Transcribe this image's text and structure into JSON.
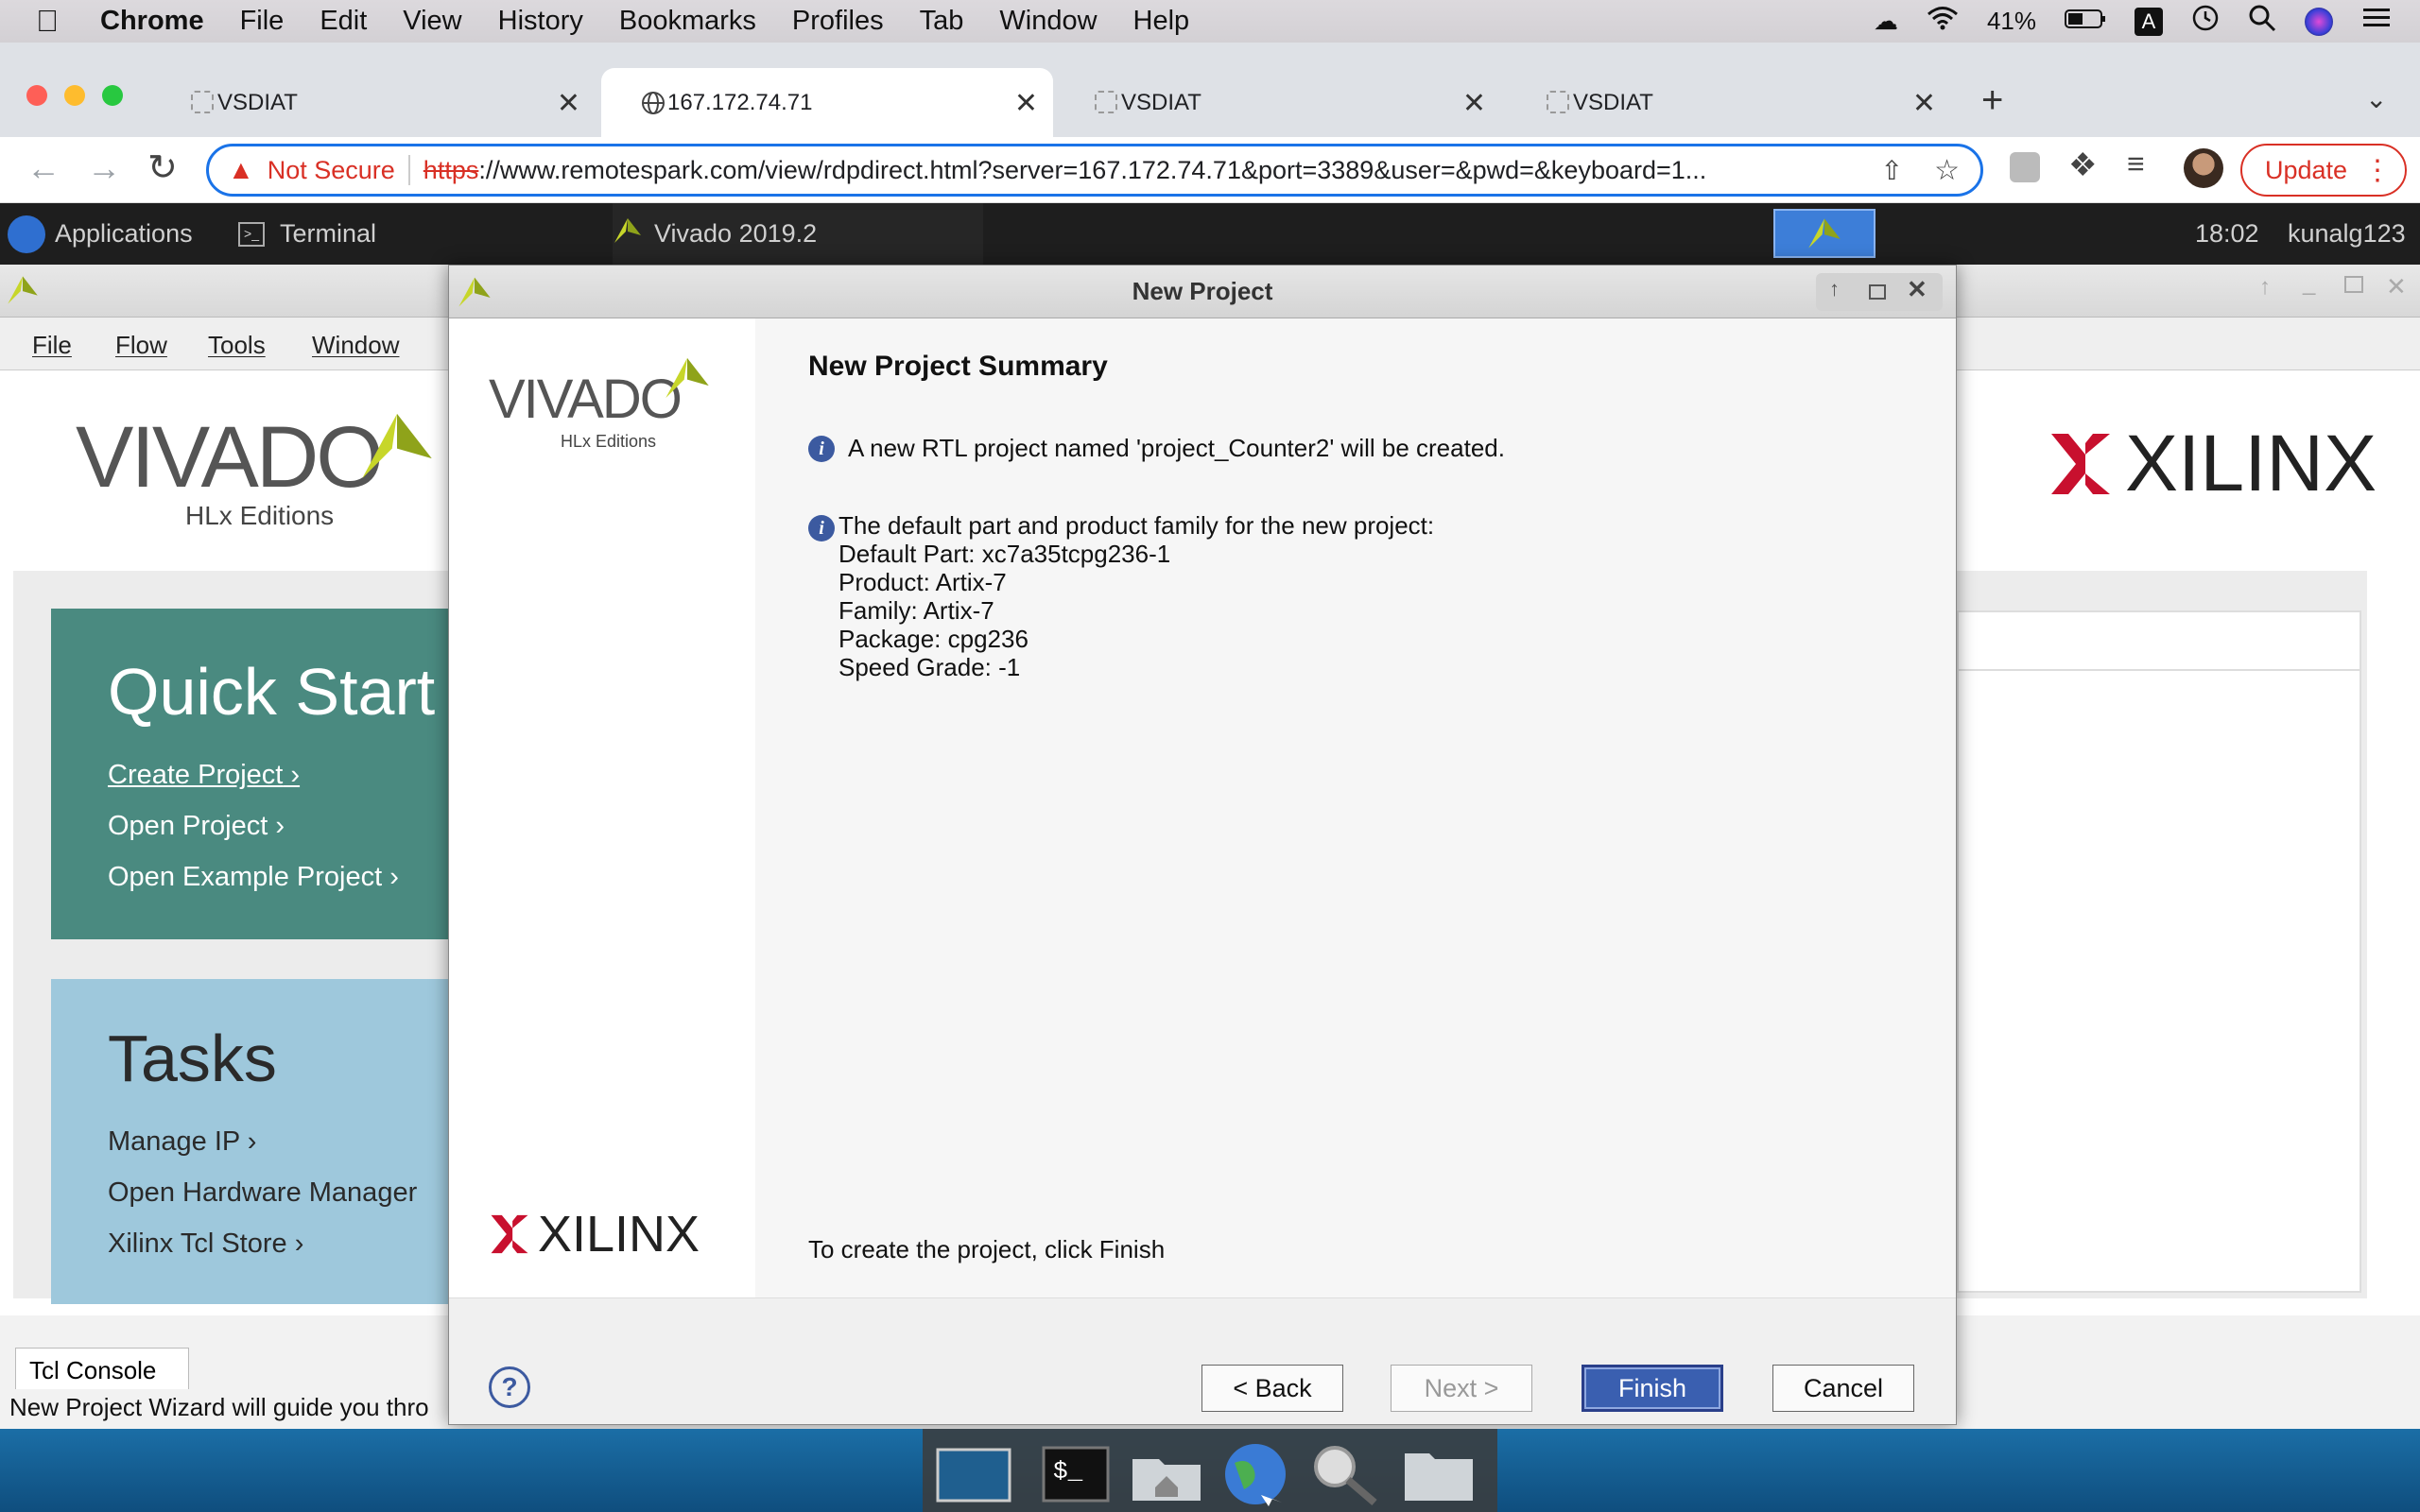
{
  "mac_menu": {
    "app": "Chrome",
    "items": [
      "File",
      "Edit",
      "View",
      "History",
      "Bookmarks",
      "Profiles",
      "Tab",
      "Window",
      "Help"
    ],
    "battery": "41%"
  },
  "browser": {
    "tabs": [
      {
        "title": "VSDIAT",
        "active": false
      },
      {
        "title": "167.172.74.71",
        "active": true
      },
      {
        "title": "VSDIAT",
        "active": false
      },
      {
        "title": "VSDIAT",
        "active": false
      }
    ],
    "omnibox": {
      "security": "Not Secure",
      "scheme": "https",
      "url_rest": "://www.remotespark.com/view/rdpdirect.html?server=167.172.74.71&port=3389&user=&pwd=&keyboard=1..."
    },
    "update_label": "Update"
  },
  "remote_panel": {
    "applications": "Applications",
    "terminal": "Terminal",
    "vivado_task": "Vivado 2019.2",
    "clock": "18:02",
    "user": "kunalg123"
  },
  "vivado": {
    "menus": [
      "File",
      "Flow",
      "Tools",
      "Window"
    ],
    "logo_main": "VIVADO",
    "logo_sub": "HLx Editions",
    "xilinx": "XILINX",
    "quick_start": {
      "title": "Quick Start",
      "links": [
        "Create Project",
        "Open Project",
        "Open Example Project"
      ]
    },
    "tasks": {
      "title": "Tasks",
      "links": [
        "Manage IP",
        "Open Hardware Manager",
        "Xilinx Tcl Store"
      ]
    },
    "console_tab": "Tcl Console",
    "status": "New Project Wizard will guide you thro"
  },
  "dialog": {
    "title": "New Project",
    "heading": "New Project Summary",
    "info1": "A new RTL project named 'project_Counter2' will be created.",
    "info2_title": "The default part and product family for the new project:",
    "part_lines": [
      "Default Part: xc7a35tcpg236-1",
      "Product: Artix-7",
      "Family: Artix-7",
      "Package: cpg236",
      "Speed Grade: -1"
    ],
    "footer_note": "To create the project, click Finish",
    "buttons": {
      "back": "< Back",
      "next": "Next >",
      "finish": "Finish",
      "cancel": "Cancel"
    },
    "logo_main": "VIVADO",
    "logo_sub": "HLx Editions",
    "xilinx": "XILINX"
  },
  "colors": {
    "quick_start_bg": "#4a8a80",
    "tasks_bg": "#9ec8dc",
    "xilinx_red": "#c8102e",
    "finish_bg": "#3a5fb0"
  }
}
